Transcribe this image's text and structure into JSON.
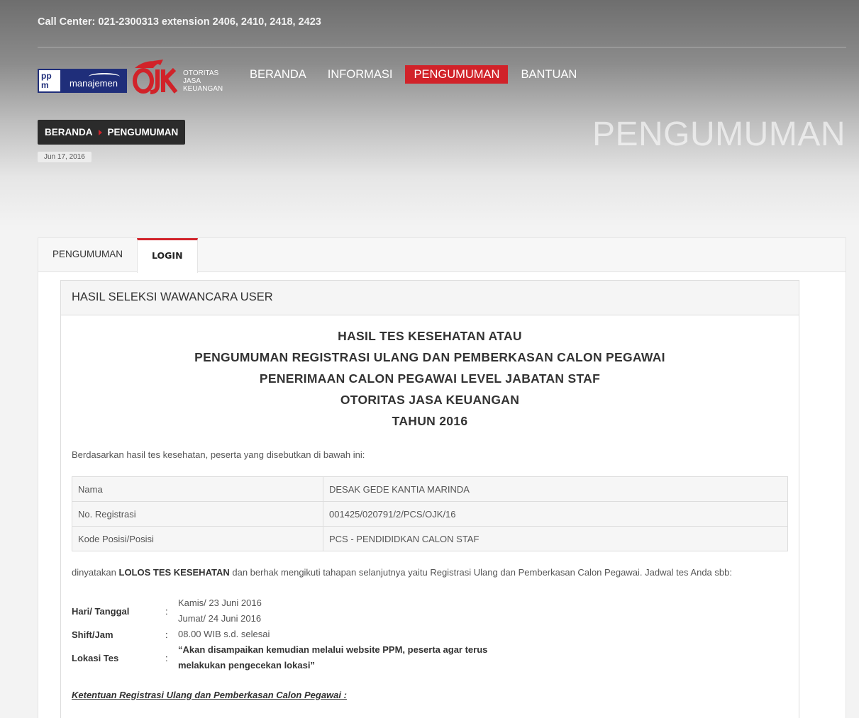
{
  "topbar": {
    "call_center": "Call Center: 021-2300313 extension 2406, 2410, 2418, 2423"
  },
  "logos": {
    "ppm_text": "manajemen",
    "ojk_text_line1": "OTORITAS",
    "ojk_text_line2": "JASA",
    "ojk_text_line3": "KEUANGAN"
  },
  "nav": {
    "items": [
      {
        "label": "BERANDA"
      },
      {
        "label": "INFORMASI"
      },
      {
        "label": "PENGUMUMAN"
      },
      {
        "label": "BANTUAN"
      }
    ]
  },
  "breadcrumb": {
    "home": "BERANDA",
    "current": "PENGUMUMAN"
  },
  "date": "Jun 17, 2016",
  "page_heading": "PENGUMUMAN",
  "tabs": [
    {
      "label": "PENGUMUMAN"
    },
    {
      "label": "LOGIN"
    }
  ],
  "card": {
    "header": "HASIL SELEKSI WAWANCARA USER",
    "title_lines": [
      "HASIL TES KESEHATAN ATAU",
      "PENGUMUMAN REGISTRASI ULANG DAN PEMBERKASAN CALON PEGAWAI",
      "PENERIMAAN CALON PEGAWAI LEVEL JABATAN STAF",
      "OTORITAS JASA KEUANGAN",
      "TAHUN 2016"
    ],
    "intro": "Berdasarkan hasil tes kesehatan, peserta yang disebutkan di bawah ini:",
    "table": [
      {
        "label": "Nama",
        "value": "DESAK GEDE KANTIA MARINDA"
      },
      {
        "label": "No. Registrasi",
        "value": "001425/020791/2/PCS/OJK/16"
      },
      {
        "label": "Kode Posisi/Posisi",
        "value": "PCS - PENDIDIDKAN CALON STAF"
      }
    ],
    "result_prefix": "dinyatakan ",
    "result_bold": "LOLOS TES KESEHATAN",
    "result_suffix": " dan berhak mengikuti tahapan selanjutnya yaitu Registrasi Ulang dan Pemberkasan Calon Pegawai. Jadwal tes Anda sbb:",
    "schedule": {
      "date_label": "Hari/ Tanggal",
      "date_value_1": "Kamis/ 23 Juni 2016",
      "date_value_2": "Jumat/ 24 Juni 2016",
      "shift_label": "Shift/Jam",
      "shift_value": "08.00 WIB s.d. selesai",
      "location_label": "Lokasi Tes",
      "location_value_1": "“Akan disampaikan kemudian melalui website PPM, peserta agar terus",
      "location_value_2": "melakukan pengecekan lokasi”",
      "colon": ":"
    },
    "ketentuan": "Ketentuan Registrasi Ulang dan Pemberkasan Calon Pegawai :"
  },
  "colors": {
    "accent_red": "#d12229",
    "ppm_blue": "#1f2e7a",
    "breadcrumb_bg": "#2b2b2b"
  }
}
